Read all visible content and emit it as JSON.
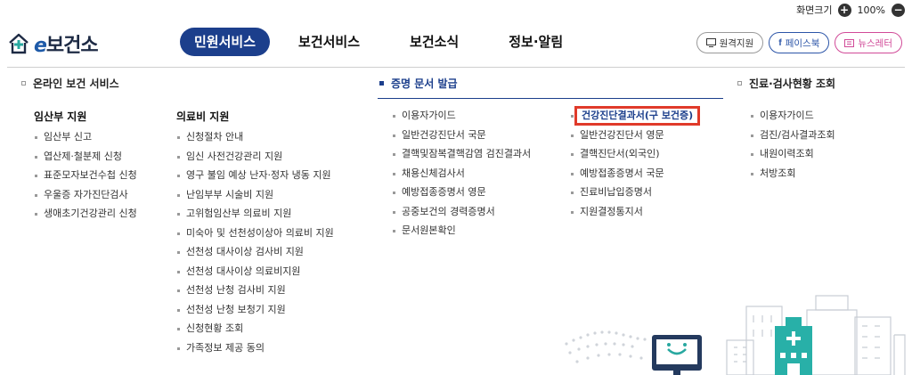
{
  "utility": {
    "zoom_label": "화면크기",
    "zoom_value": "100%",
    "zoom_in": "+",
    "zoom_out": "−"
  },
  "logo": {
    "e": "e",
    "text": "보건소"
  },
  "nav": [
    "민원서비스",
    "보건서비스",
    "보건소식",
    "정보·알림"
  ],
  "header_buttons": {
    "remote": "원격지원",
    "facebook": "페이스북",
    "newsletter": "뉴스레터"
  },
  "sections": {
    "online": {
      "title": "온라인 보건 서비스",
      "pregnancy": {
        "head": "임산부 지원",
        "items": [
          "임산부 신고",
          "엽산제·철분제 신청",
          "표준모자보건수첩 신청",
          "우울증 자가진단검사",
          "생애초기건강관리 신청"
        ]
      },
      "medical": {
        "head": "의료비 지원",
        "items": [
          "신청절차 안내",
          "임신 사전건강관리 지원",
          "영구 불임 예상 난자·정자 냉동 지원",
          "난임부부 시술비 지원",
          "고위험임산부 의료비 지원",
          "미숙아 및 선천성이상아 의료비 지원",
          "선천성 대사이상 검사비 지원",
          "선천성 대사이상 의료비지원",
          "선천성 난청 검사비 지원",
          "선천성 난청 보청기 지원",
          "신청현황 조회",
          "가족정보 제공 동의"
        ]
      }
    },
    "certificate": {
      "title": "증명 문서 발급",
      "col1": [
        "이용자가이드",
        "일반건강진단서 국문",
        "결핵및잠복결핵감염 검진결과서",
        "채용신체검사서",
        "예방접종증명서 영문",
        "공중보건의 경력증명서",
        "문서원본확인"
      ],
      "col2": [
        "건강진단결과서(구 보건증)",
        "일반건강진단서 영문",
        "결핵진단서(외국인)",
        "예방접종증명서 국문",
        "진료비납입증명서",
        "지원결정통지서"
      ]
    },
    "exam": {
      "title": "진료·검사현황 조회",
      "items": [
        "이용자가이드",
        "검진/검사결과조회",
        "내원이력조회",
        "처방조회"
      ]
    }
  }
}
